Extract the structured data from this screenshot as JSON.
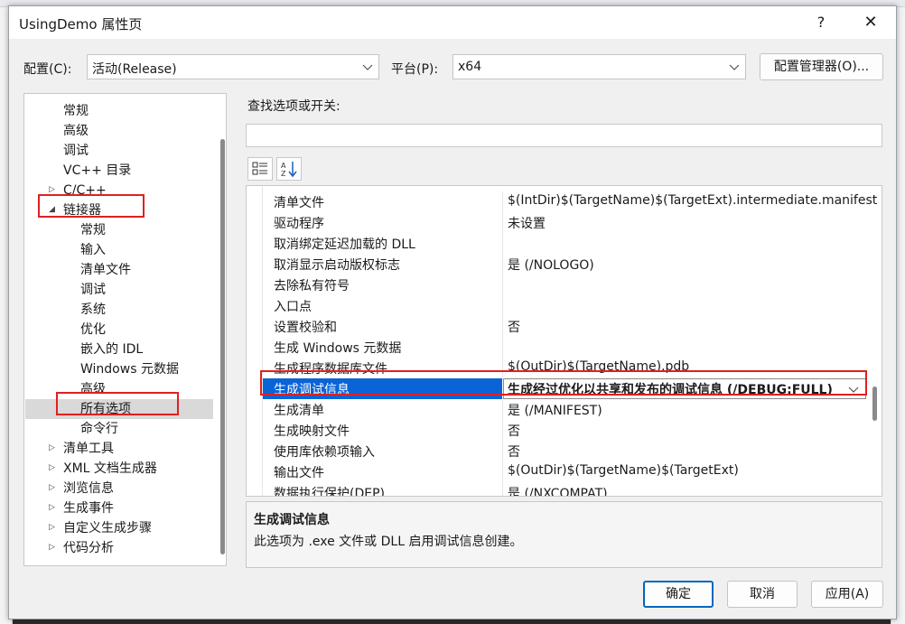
{
  "title": "UsingDemo 属性页",
  "help_label": "?",
  "close_label": "✕",
  "config": {
    "label": "配置(C):",
    "value": "活动(Release)",
    "platform_label": "平台(P):",
    "platform_value": "x64",
    "manager_button": "配置管理器(O)..."
  },
  "tree": {
    "items": [
      {
        "label": "常规",
        "level": 1,
        "expander": ""
      },
      {
        "label": "高级",
        "level": 1,
        "expander": ""
      },
      {
        "label": "调试",
        "level": 1,
        "expander": ""
      },
      {
        "label": "VC++ 目录",
        "level": 1,
        "expander": ""
      },
      {
        "label": "C/C++",
        "level": 1,
        "expander": "collapsed"
      },
      {
        "label": "链接器",
        "level": 1,
        "expander": "expanded"
      },
      {
        "label": "常规",
        "level": 2,
        "expander": ""
      },
      {
        "label": "输入",
        "level": 2,
        "expander": ""
      },
      {
        "label": "清单文件",
        "level": 2,
        "expander": ""
      },
      {
        "label": "调试",
        "level": 2,
        "expander": ""
      },
      {
        "label": "系统",
        "level": 2,
        "expander": ""
      },
      {
        "label": "优化",
        "level": 2,
        "expander": ""
      },
      {
        "label": "嵌入的 IDL",
        "level": 2,
        "expander": ""
      },
      {
        "label": "Windows 元数据",
        "level": 2,
        "expander": ""
      },
      {
        "label": "高级",
        "level": 2,
        "expander": ""
      },
      {
        "label": "所有选项",
        "level": 2,
        "expander": "",
        "selected": true
      },
      {
        "label": "命令行",
        "level": 2,
        "expander": ""
      },
      {
        "label": "清单工具",
        "level": 1,
        "expander": "collapsed"
      },
      {
        "label": "XML 文档生成器",
        "level": 1,
        "expander": "collapsed"
      },
      {
        "label": "浏览信息",
        "level": 1,
        "expander": "collapsed"
      },
      {
        "label": "生成事件",
        "level": 1,
        "expander": "collapsed"
      },
      {
        "label": "自定义生成步骤",
        "level": 1,
        "expander": "collapsed"
      },
      {
        "label": "代码分析",
        "level": 1,
        "expander": "collapsed"
      }
    ]
  },
  "search": {
    "label": "查找选项或开关:",
    "value": ""
  },
  "grid": {
    "rows": [
      {
        "name": "清单文件",
        "value": "$(IntDir)$(TargetName)$(TargetExt).intermediate.manifest"
      },
      {
        "name": "驱动程序",
        "value": "未设置"
      },
      {
        "name": "取消绑定延迟加载的 DLL",
        "value": ""
      },
      {
        "name": "取消显示启动版权标志",
        "value": "是 (/NOLOGO)"
      },
      {
        "name": "去除私有符号",
        "value": ""
      },
      {
        "name": "入口点",
        "value": ""
      },
      {
        "name": "设置校验和",
        "value": "否"
      },
      {
        "name": "生成 Windows 元数据",
        "value": ""
      },
      {
        "name": "生成程序数据库文件",
        "value": "$(OutDir)$(TargetName).pdb"
      },
      {
        "name": "生成调试信息",
        "value": "生成经过优化以共享和发布的调试信息 (/DEBUG:FULL)",
        "selected": true
      },
      {
        "name": "生成清单",
        "value": "是 (/MANIFEST)"
      },
      {
        "name": "生成映射文件",
        "value": "否"
      },
      {
        "name": "使用库依赖项输入",
        "value": "否"
      },
      {
        "name": "输出文件",
        "value": "$(OutDir)$(TargetName)$(TargetExt)"
      },
      {
        "name": "数据执行保护(DEP)",
        "value": "是 (/NXCOMPAT)"
      }
    ]
  },
  "description": {
    "title": "生成调试信息",
    "text": "此选项为 .exe 文件或 DLL 启用调试信息创建。"
  },
  "buttons": {
    "ok": "确定",
    "cancel": "取消",
    "apply": "应用(A)"
  },
  "colors": {
    "selection": "#0a64d6",
    "highlight_box": "#e02020"
  },
  "icons": {
    "categorized": "categorized-view-icon",
    "sort": "alphabetical-sort-icon"
  }
}
